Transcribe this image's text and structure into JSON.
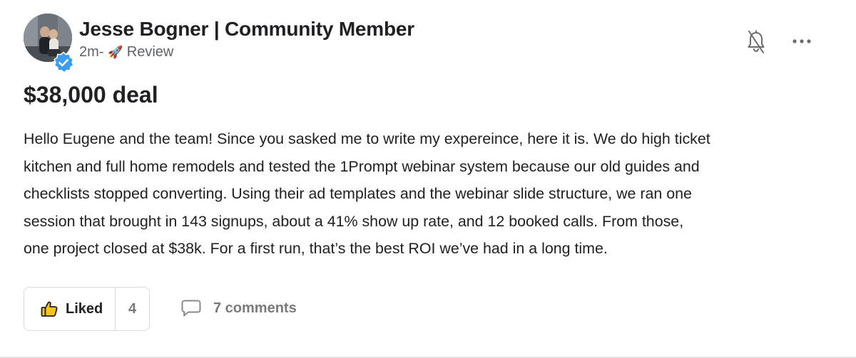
{
  "post": {
    "author": {
      "name": "Jesse Bogner | Community Member",
      "time": "2m-",
      "category_emoji": "🚀",
      "category": "Review",
      "verified_color": "#3b9cf0"
    },
    "title": "$38,000 deal",
    "body_lines": [
      "Hello Eugene and the team! Since you sasked me to write my expereince, here it is. We do high ticket",
      "kitchen and full home remodels and tested the 1Prompt webinar system because our old guides and",
      "checklists stopped converting. Using their ad templates and the webinar slide structure, we ran one",
      "session that brought in 143 signups, about a 41% show up rate, and 12 booked calls. From those,",
      "one project closed at $38k. For a first run, that’s the best ROI we’ve had in a long time."
    ],
    "actions": {
      "like_label": "Liked",
      "like_count": "4",
      "like_icon": "thumbs-up-icon",
      "like_icon_color": "#f5c518",
      "comments_label": "7 comments",
      "comments_icon": "comment-bubble-icon"
    },
    "header_icons": {
      "notification": "bell-off-icon",
      "more": "more-horizontal-icon"
    }
  }
}
